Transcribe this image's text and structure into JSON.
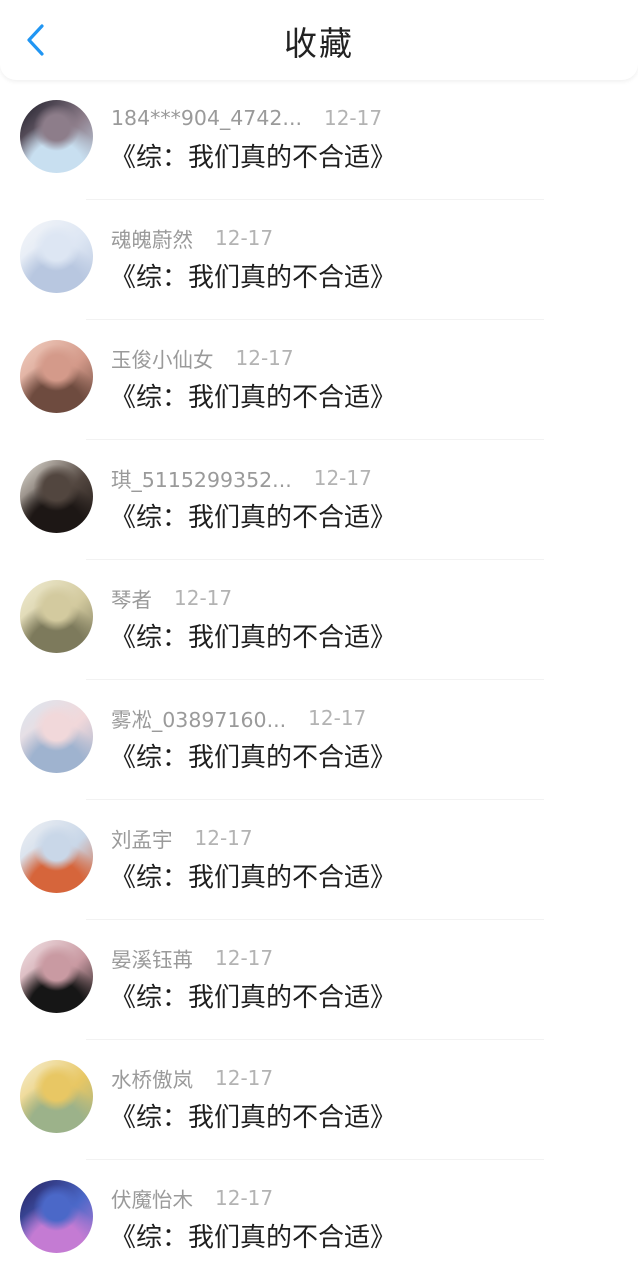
{
  "header": {
    "title": "收藏",
    "back_icon": "chevron-left-icon",
    "accent_color": "#2196f3"
  },
  "favorites": [
    {
      "username": "184***904_4742...",
      "date": "12-17",
      "title": "《综：我们真的不合适》",
      "avatar_colors": [
        "#1b1a26",
        "#8d7d8a",
        "#c8dff0"
      ]
    },
    {
      "username": "魂魄蔚然",
      "date": "12-17",
      "title": "《综：我们真的不合适》",
      "avatar_colors": [
        "#f4f6f9",
        "#dde6f3",
        "#b8c7e0"
      ]
    },
    {
      "username": "玉俊小仙女",
      "date": "12-17",
      "title": "《综：我们真的不合适》",
      "avatar_colors": [
        "#f1cfc1",
        "#d49a8a",
        "#6e4b3f"
      ]
    },
    {
      "username": "琪_5115299352...",
      "date": "12-17",
      "title": "《综：我们真的不合适》",
      "avatar_colors": [
        "#e6e2da",
        "#52463f",
        "#1d1715"
      ]
    },
    {
      "username": "琴者",
      "date": "12-17",
      "title": "《综：我们真的不合适》",
      "avatar_colors": [
        "#f0ecd2",
        "#d3ca9f",
        "#7d7a5c"
      ]
    },
    {
      "username": "雾凇_03897160...",
      "date": "12-17",
      "title": "《综：我们真的不合适》",
      "avatar_colors": [
        "#dbe6f0",
        "#f1d8da",
        "#9fb3cf"
      ]
    },
    {
      "username": "刘孟宇",
      "date": "12-17",
      "title": "《综：我们真的不合适》",
      "avatar_colors": [
        "#eef0f4",
        "#c9d7e8",
        "#d6653b"
      ]
    },
    {
      "username": "晏溪钰苒",
      "date": "12-17",
      "title": "《综：我们真的不合适》",
      "avatar_colors": [
        "#f2e3e6",
        "#c99aa2",
        "#161616"
      ]
    },
    {
      "username": "水桥傲岚",
      "date": "12-17",
      "title": "《综：我们真的不合适》",
      "avatar_colors": [
        "#f6efd3",
        "#e8c764",
        "#9cb28a"
      ]
    },
    {
      "username": "伏魔怡木",
      "date": "12-17",
      "title": "《综：我们真的不合适》",
      "avatar_colors": [
        "#241f5c",
        "#4b68c8",
        "#c47bd3"
      ]
    }
  ]
}
